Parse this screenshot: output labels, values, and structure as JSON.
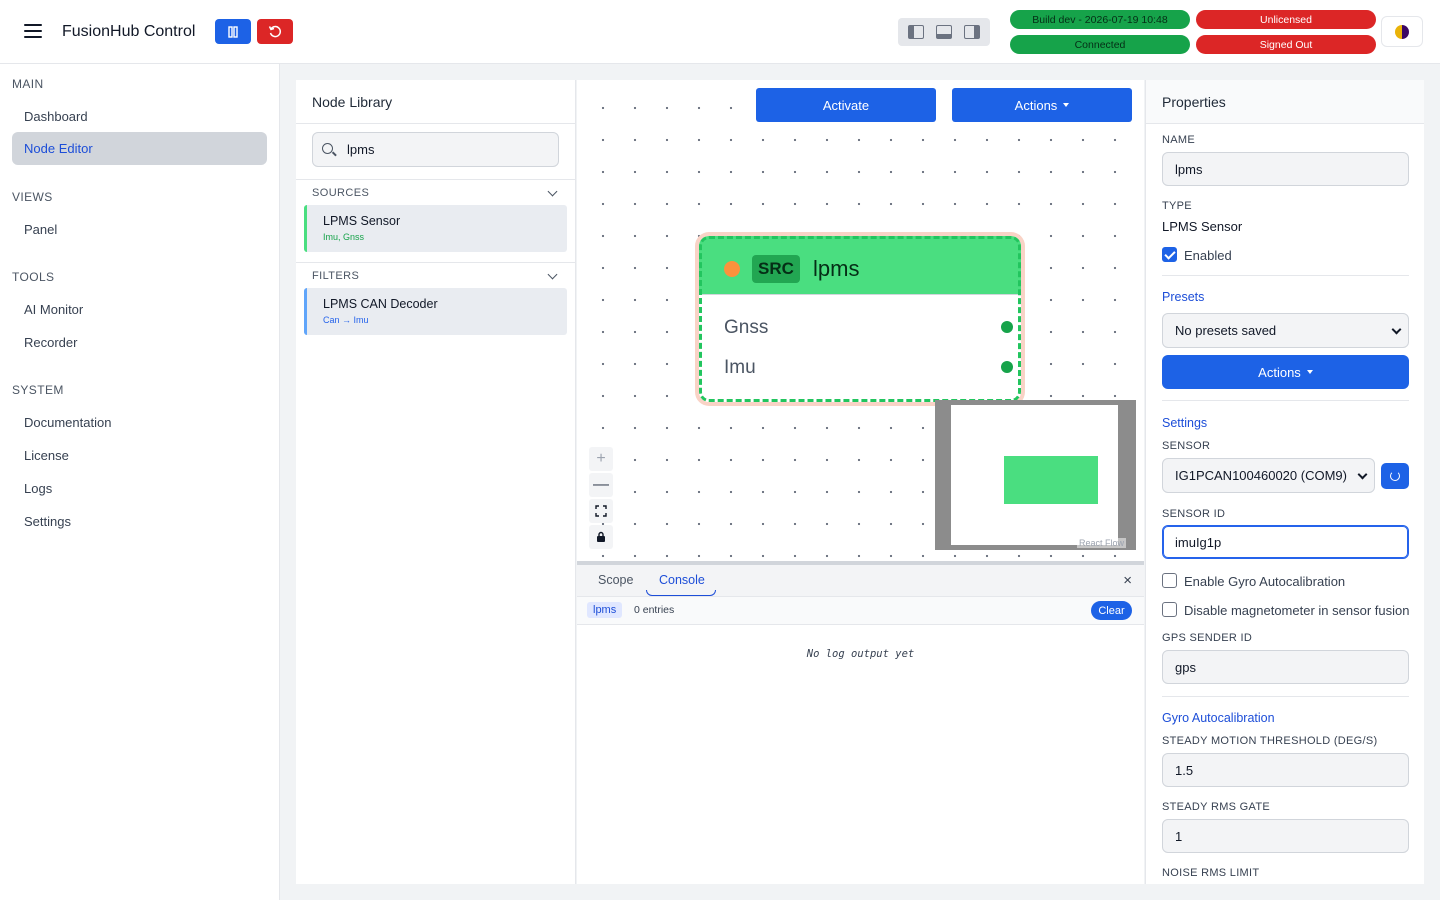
{
  "app": {
    "title": "FusionHub Control"
  },
  "topbar": {
    "build": "Build dev - 2026-07-19 10:48",
    "connection": "Connected",
    "license": "Unlicensed",
    "auth": "Signed Out",
    "colors": {
      "primary": "#1d62e6",
      "danger": "#dc2626",
      "success": "#16a34a"
    }
  },
  "sidebar": {
    "sections": [
      {
        "title": "MAIN",
        "items": [
          "Dashboard",
          "Node Editor"
        ]
      },
      {
        "title": "VIEWS",
        "items": [
          "Panel"
        ]
      },
      {
        "title": "TOOLS",
        "items": [
          "AI Monitor",
          "Recorder"
        ]
      },
      {
        "title": "SYSTEM",
        "items": [
          "Documentation",
          "License",
          "Logs",
          "Settings"
        ]
      }
    ],
    "active": "Node Editor"
  },
  "library": {
    "title": "Node Library",
    "search_value": "lpms",
    "categories": [
      {
        "title": "SOURCES",
        "nodes": [
          {
            "name": "LPMS Sensor",
            "sub": "Imu, Gnss"
          }
        ]
      },
      {
        "title": "FILTERS",
        "nodes": [
          {
            "name": "LPMS CAN Decoder",
            "sub": "Can → Imu"
          }
        ]
      }
    ]
  },
  "canvas": {
    "activate_label": "Activate",
    "actions_label": "Actions",
    "node": {
      "tag": "SRC",
      "title": "lpms",
      "ports": [
        "Gnss",
        "Imu"
      ],
      "color": "#4ade80"
    },
    "zoom": {
      "in": "+",
      "out": "—"
    },
    "attribution": "React Flow"
  },
  "console": {
    "tabs": [
      "Scope",
      "Console"
    ],
    "active_tab": "Console",
    "filter": "lpms",
    "entries": "0 entries",
    "clear_label": "Clear",
    "empty": "No log output yet",
    "close": "×"
  },
  "properties": {
    "title": "Properties",
    "name_label": "NAME",
    "name_value": "lpms",
    "type_label": "TYPE",
    "type_value": "LPMS Sensor",
    "enabled_label": "Enabled",
    "enabled": true,
    "presets_title": "Presets",
    "presets_select": "No presets saved",
    "actions_label": "Actions",
    "settings_title": "Settings",
    "sensor_label": "SENSOR",
    "sensor_value": "IG1PCAN100460020 (COM9)",
    "sensor_id_label": "SENSOR ID",
    "sensor_id_value": "imuIg1p",
    "gyro_autocal_label": "Enable Gyro Autocalibration",
    "disable_mag_label": "Disable magnetometer in sensor fusion",
    "gps_sender_label": "GPS SENDER ID",
    "gps_sender_value": "gps",
    "gyro_section": "Gyro Autocalibration",
    "steady_motion_label": "STEADY MOTION THRESHOLD (DEG/S)",
    "steady_motion_value": "1.5",
    "steady_rms_label": "STEADY RMS GATE",
    "steady_rms_value": "1",
    "noise_rms_label": "NOISE RMS LIMIT"
  }
}
